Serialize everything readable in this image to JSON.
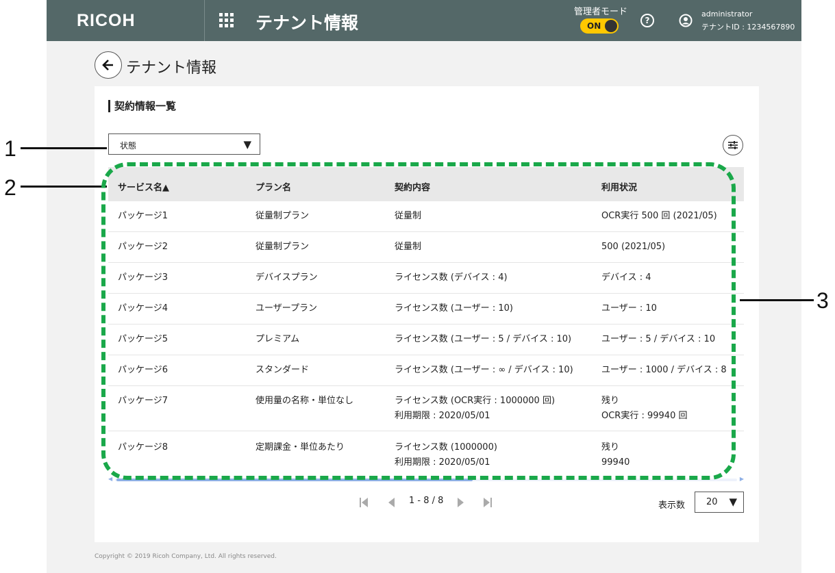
{
  "header": {
    "brand": "RICOH",
    "title": "テナント情報",
    "admin_mode_label": "管理者モード",
    "admin_toggle": "ON",
    "user_name": "administrator",
    "tenant_id": "テナントID : 1234567890"
  },
  "page": {
    "title": "テナント情報"
  },
  "section": {
    "title": "契約情報一覧"
  },
  "filter": {
    "status_value": "状態"
  },
  "table": {
    "columns": [
      "サービス名▲",
      "プラン名",
      "契約内容",
      "利用状況"
    ],
    "rows": [
      {
        "service": "パッケージ1",
        "plan": "従量制プラン",
        "contract": "従量制",
        "contract2": "",
        "usage": "OCR実行 500 回 (2021/05)",
        "usage2": ""
      },
      {
        "service": "パッケージ2",
        "plan": "従量制プラン",
        "contract": "従量制",
        "contract2": "",
        "usage": "500 (2021/05)",
        "usage2": ""
      },
      {
        "service": "パッケージ3",
        "plan": "デバイスプラン",
        "contract": "ライセンス数 (デバイス : 4)",
        "contract2": "",
        "usage": "デバイス : 4",
        "usage2": ""
      },
      {
        "service": "パッケージ4",
        "plan": "ユーザープラン",
        "contract": "ライセンス数 (ユーザー : 10)",
        "contract2": "",
        "usage": "ユーザー : 10",
        "usage2": ""
      },
      {
        "service": "パッケージ5",
        "plan": "プレミアム",
        "contract": "ライセンス数 (ユーザー : 5 / デバイス : 10)",
        "contract2": "",
        "usage": "ユーザー : 5 / デバイス : 10",
        "usage2": ""
      },
      {
        "service": "パッケージ6",
        "plan": "スタンダード",
        "contract": "ライセンス数 (ユーザー : ∞ / デバイス : 10)",
        "contract2": "",
        "usage": "ユーザー : 1000 / デバイス : 8",
        "usage2": ""
      },
      {
        "service": "パッケージ7",
        "plan": "使用量の名称・単位なし",
        "contract": "ライセンス数 (OCR実行 : 1000000 回)",
        "contract2": "利用期限 : 2020/05/01",
        "usage": "残り",
        "usage2": "OCR実行 : 99940 回"
      },
      {
        "service": "パッケージ8",
        "plan": "定期課金・単位あたり",
        "contract": "ライセンス数 (1000000)",
        "contract2": "利用期限 : 2020/05/01",
        "usage": "残り",
        "usage2": "99940"
      }
    ]
  },
  "pagination": {
    "range": "1 - 8 / 8",
    "page_size_label": "表示数",
    "page_size": "20"
  },
  "footer": {
    "copyright": "Copyright © 2019 Ricoh Company, Ltd. All rights reserved."
  },
  "callouts": [
    "1",
    "2",
    "3"
  ],
  "colors": {
    "header_bg": "#546868",
    "toggle_on": "#ffc800",
    "callout_dash": "#1aa84a",
    "scroll_thumb": "#8fb0e6"
  }
}
